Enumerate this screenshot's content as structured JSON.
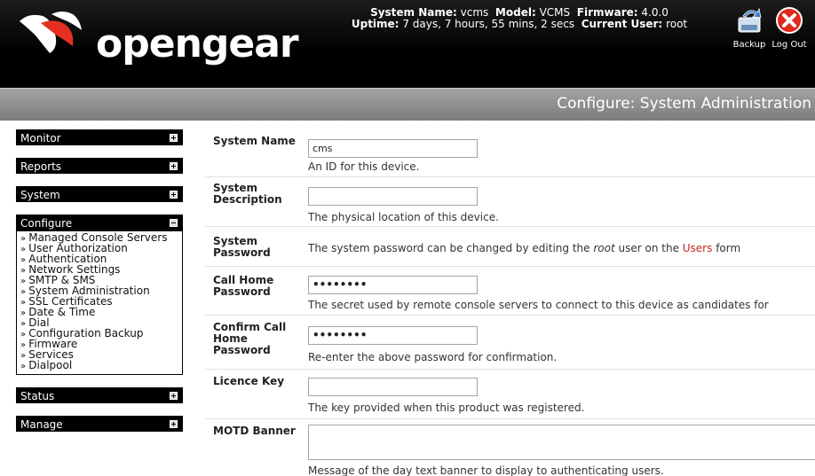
{
  "header": {
    "logo_text": "opengear",
    "system_name_label": "System Name:",
    "system_name": "vcms",
    "model_label": "Model:",
    "model": "VCMS",
    "firmware_label": "Firmware:",
    "firmware": "4.0.0",
    "uptime_label": "Uptime:",
    "uptime": "7 days, 7 hours, 55 mins, 2 secs",
    "user_label": "Current User:",
    "user": "root",
    "backup_label": "Backup",
    "logout_label": "Log Out"
  },
  "title": "Configure: System Administration",
  "sidebar": {
    "monitor": "Monitor",
    "reports": "Reports",
    "system": "System",
    "configure": "Configure",
    "configure_items": [
      "Managed Console Servers",
      "User Authorization",
      "Authentication",
      "Network Settings",
      "SMTP & SMS",
      "System Administration",
      "SSL Certificates",
      "Date & Time",
      "Dial",
      "Configuration Backup",
      "Firmware",
      "Services",
      "Dialpool"
    ],
    "status": "Status",
    "manage": "Manage"
  },
  "form": {
    "system_name": {
      "label": "System Name",
      "value": "cms",
      "hint": "An ID for this device."
    },
    "system_description": {
      "label": "System Description",
      "value": "",
      "hint": "The physical location of this device."
    },
    "system_password": {
      "label": "System Password",
      "hint_pre": "The system password can be changed by editing the ",
      "hint_em": "root",
      "hint_mid": " user on the ",
      "hint_link": "Users",
      "hint_post": " form"
    },
    "call_home_password": {
      "label": "Call Home Password",
      "value": "••••••••",
      "hint": "The secret used by remote console servers to connect to this device as candidates for"
    },
    "confirm_call_home_password": {
      "label": "Confirm Call Home Password",
      "value": "••••••••",
      "hint": "Re-enter the above password for confirmation."
    },
    "licence_key": {
      "label": "Licence Key",
      "value": "",
      "hint": "The key provided when this product was registered."
    },
    "motd_banner": {
      "label": "MOTD Banner",
      "value": "",
      "hint": "Message of the day text banner to display to authenticating users."
    }
  },
  "colors": {
    "header_bg": "#000000",
    "titlebar_bg": "#8c8c8c",
    "link": "#c4261d",
    "menu_bg": "#000000"
  }
}
